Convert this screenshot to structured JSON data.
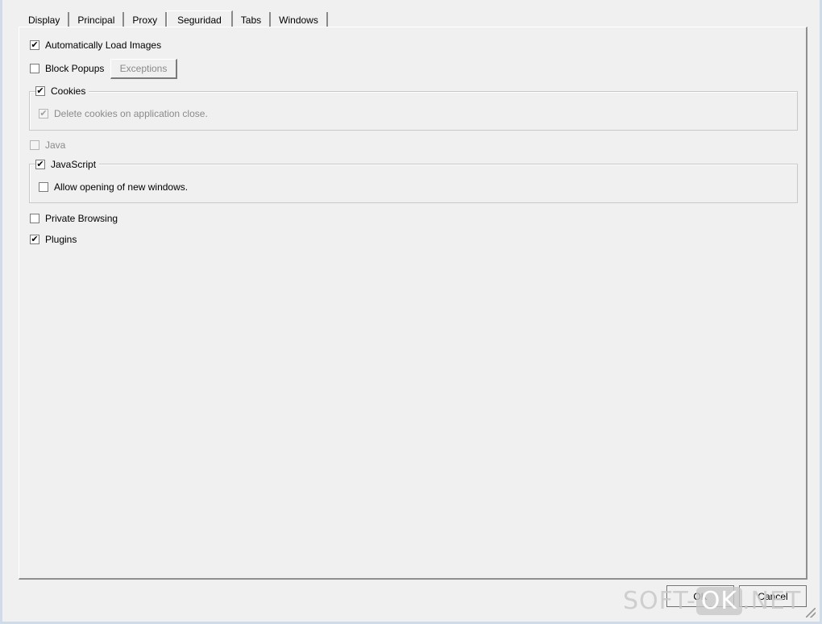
{
  "tabs": [
    {
      "label": "Display",
      "active": false
    },
    {
      "label": "Principal",
      "active": false
    },
    {
      "label": "Proxy",
      "active": false
    },
    {
      "label": "Seguridad",
      "active": true
    },
    {
      "label": "Tabs",
      "active": false
    },
    {
      "label": "Windows",
      "active": false
    }
  ],
  "security": {
    "auto_load_images": {
      "label": "Automatically Load Images",
      "checked": true
    },
    "block_popups": {
      "label": "Block Popups",
      "checked": false
    },
    "exceptions_button": "Exceptions",
    "cookies": {
      "label": "Cookies",
      "checked": true
    },
    "delete_cookies": {
      "label": "Delete cookies on application close.",
      "checked": true,
      "disabled": true
    },
    "java": {
      "label": "Java",
      "checked": false,
      "disabled": true
    },
    "javascript": {
      "label": "JavaScript",
      "checked": true
    },
    "allow_new_windows": {
      "label": "Allow opening of new windows.",
      "checked": false
    },
    "private_browsing": {
      "label": "Private Browsing",
      "checked": false
    },
    "plugins": {
      "label": "Plugins",
      "checked": true
    }
  },
  "footer": {
    "ok_label": "OK",
    "cancel_label": "Cancel"
  },
  "watermark": {
    "prefix": "SOFT-",
    "ok": "OK",
    "suffix": ".NET"
  },
  "check_glyph": "✔"
}
